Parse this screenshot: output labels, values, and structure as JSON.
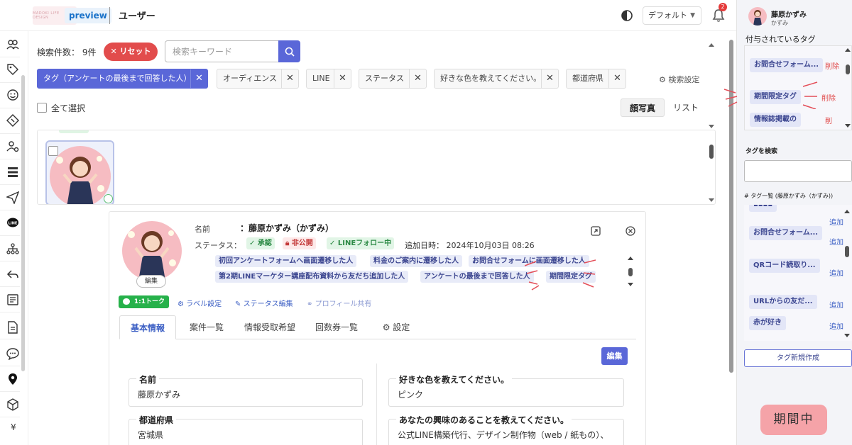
{
  "header": {
    "logo_text": "MADOKI LIFE DESIGN",
    "preview_label": "preview",
    "page_title": "ユーザー",
    "view_select": "デフォルト",
    "notification_count": "2"
  },
  "list": {
    "count_label": "検索件数：",
    "count_value": "9件",
    "reset_label": "リセット",
    "search_placeholder": "検索キーワード",
    "filters": [
      {
        "label": "タグ（アンケートの最後まで回答した人）",
        "active": true
      },
      {
        "label": "オーディエンス"
      },
      {
        "label": "LINE"
      },
      {
        "label": "ステータス"
      },
      {
        "label": "好きな色を教えてください。"
      },
      {
        "label": "都道府県"
      }
    ],
    "search_settings": "検索設定",
    "select_all": "全て選択",
    "view_modes": [
      "顔写真",
      "リスト"
    ]
  },
  "detail": {
    "name_label": "名前",
    "name_value": "：藤原かずみ（かずみ）",
    "status_label": "ステータス：",
    "status_badges": [
      "承認",
      "非公開",
      "LINEフォロー中"
    ],
    "added_label": "追加日時：",
    "added_value": "2024年10月03日 08:26",
    "avatar_edit": "編集",
    "tags": [
      "初回アンケートフォームへ画面遷移した人",
      "料金のご案内に遷移した人",
      "お問合せフォームに画面遷移した人",
      "第2期LINEマーケター講座配布資料から友だち追加した人",
      "アンケートの最後まで回答した人",
      "期間限定タグ"
    ],
    "actions": {
      "talk": "1:1トーク",
      "label_settings": "ラベル設定",
      "status_edit": "ステータス編集",
      "profile_share": "プロフィール共有"
    },
    "tabs": [
      "基本情報",
      "案件一覧",
      "情報受取希望",
      "回数券一覧",
      "設定"
    ],
    "edit_button": "編集",
    "fields": {
      "name": {
        "label": "名前",
        "value": "藤原かずみ"
      },
      "prefecture": {
        "label": "都道府県",
        "value": "宮城県"
      },
      "color": {
        "label": "好きな色を教えてください。",
        "value": "ピンク"
      },
      "interest": {
        "label": "あなたの興味のあることを教えてください。",
        "value": "公式LINE構築代行、デザイン制作物（web / 紙もの）、"
      }
    }
  },
  "tag_panel": {
    "user_name": "藤原かずみ",
    "user_sub": "かずみ",
    "assigned_heading": "付与されているタグ",
    "assigned": [
      {
        "label": "お問合せフォーム...",
        "action": "削除"
      },
      {
        "label": "期間限定タグ",
        "action": "削除"
      },
      {
        "label": "情報誌掲載の",
        "action": "削"
      }
    ],
    "search_label": "タグを検索",
    "list_heading": "# タグ一覧",
    "list_user": "(藤原かずみ（かずみ))",
    "list": [
      {
        "label": "お問合せフォーム...",
        "action": "追加"
      },
      {
        "label": "QRコード読取り...",
        "action": "追加"
      },
      {
        "label": "URLからの友だ...",
        "action": "追加"
      },
      {
        "label": "赤が好き",
        "action": "追加"
      }
    ],
    "first_add": "追加",
    "new_tag_button": "タグ新規作成"
  },
  "period_badge": "期間中",
  "colors": {
    "accent": "#5a67d8",
    "danger": "#e24c4c",
    "line_green": "#26b14a",
    "period_pink": "#f5a3a8"
  }
}
